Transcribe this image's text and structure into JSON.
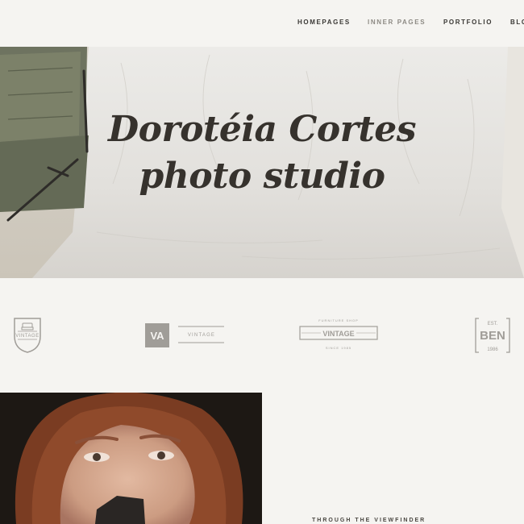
{
  "nav": {
    "items": [
      {
        "label": "HOMEPAGES"
      },
      {
        "label": "INNER PAGES"
      },
      {
        "label": "PORTFOLIO"
      },
      {
        "label": "BLO"
      }
    ]
  },
  "hero": {
    "title_line1": "Dorotéia Cortes",
    "title_line2": "photo studio"
  },
  "logos": {
    "shield_text": "VINTAGE",
    "va_monogram": "VA",
    "va_text": "VINTAGE",
    "furniture_top": "FURNITURE SHOP",
    "furniture_main": "VINTAGE",
    "furniture_bottom": "SINCE 1985",
    "ben_est": "EST.",
    "ben_main": "BEN",
    "ben_year": "1986"
  },
  "section": {
    "eyebrow": "THROUGH THE VIEWFINDER"
  },
  "colors": {
    "background": "#f5f4f1",
    "logo_grey": "#a09d98",
    "text_dark": "#36322d"
  }
}
